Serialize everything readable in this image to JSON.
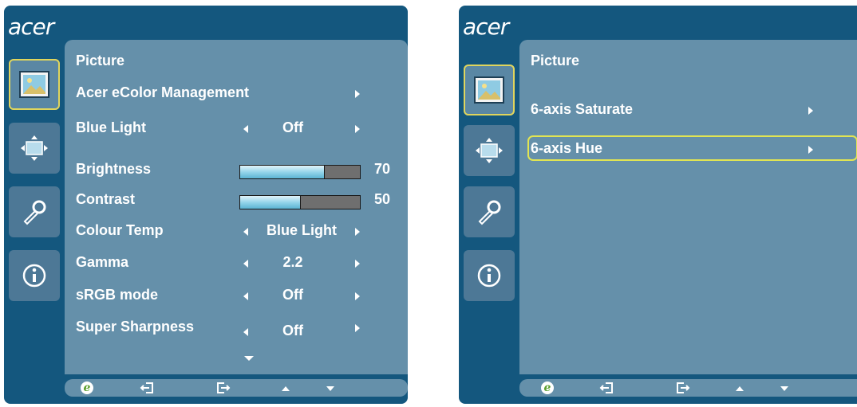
{
  "colors": {
    "osd_bg": "#14577e",
    "panel_bg": "#6590aa",
    "highlight": "#e2e552",
    "e_icon": "#5b9f2f"
  },
  "left": {
    "logo": "acer",
    "title": "Picture",
    "icons": [
      "picture-icon",
      "display-position-icon",
      "settings-wrench-icon",
      "info-icon"
    ],
    "rows": {
      "ecolor": {
        "label": "Acer eColor Management"
      },
      "bluelight": {
        "label": "Blue Light",
        "value": "Off"
      },
      "brightness": {
        "label": "Brightness",
        "value": "70",
        "level": 0.7
      },
      "contrast": {
        "label": "Contrast",
        "value": "50",
        "level": 0.5
      },
      "colourtemp": {
        "label": "Colour Temp",
        "value": "Blue Light"
      },
      "gamma": {
        "label": "Gamma",
        "value": "2.2"
      },
      "srgb": {
        "label": "sRGB mode",
        "value": "Off"
      },
      "sharp": {
        "label": "Super Sharpness",
        "value": "Off"
      }
    },
    "bottom": {
      "e": "e"
    }
  },
  "right": {
    "logo": "acer",
    "title": "Picture",
    "rows": {
      "sat": {
        "label": "6-axis Saturate"
      },
      "hue": {
        "label": "6-axis Hue"
      }
    },
    "bottom": {
      "e": "e"
    }
  }
}
